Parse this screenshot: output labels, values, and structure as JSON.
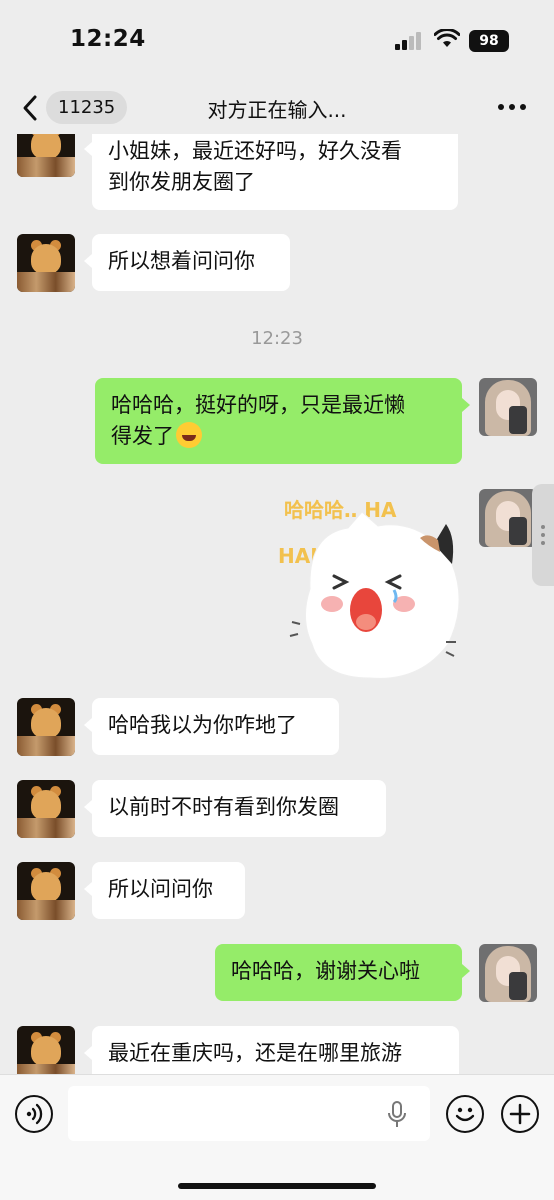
{
  "status_bar": {
    "time": "12:24",
    "battery": "98"
  },
  "nav": {
    "unread_count": "11235",
    "title": "对方正在输入..."
  },
  "messages": [
    {
      "side": "in",
      "lines": [
        "小姐妹，最近还好吗，好久没看",
        "到你发朋友圈了"
      ]
    },
    {
      "side": "in",
      "lines": [
        "所以想着问问你"
      ]
    },
    {
      "type": "time",
      "text": "12:23"
    },
    {
      "side": "out",
      "lines": [
        "哈哈哈，挺好的呀，只是最近懒",
        "得发了"
      ],
      "emoji": "laughing-tears"
    },
    {
      "side": "out",
      "type": "sticker",
      "text_top": "哈哈哈‥ HA",
      "text_side": "HAH"
    },
    {
      "side": "in",
      "lines": [
        "哈哈我以为你咋地了"
      ]
    },
    {
      "side": "in",
      "lines": [
        "以前时不时有看到你发圈"
      ]
    },
    {
      "side": "in",
      "lines": [
        "所以问问你"
      ]
    },
    {
      "side": "out",
      "lines": [
        "哈哈哈，谢谢关心啦"
      ]
    },
    {
      "side": "in",
      "lines": [
        "最近在重庆吗，还是在哪里旅游"
      ]
    }
  ],
  "colors": {
    "incoming_bubble": "#ffffff",
    "outgoing_bubble": "#95ec69",
    "background": "#ededed"
  },
  "icons": [
    "back-chevron-icon",
    "more-icon",
    "voice-icon",
    "mic-icon",
    "emoji-icon",
    "plus-icon"
  ]
}
